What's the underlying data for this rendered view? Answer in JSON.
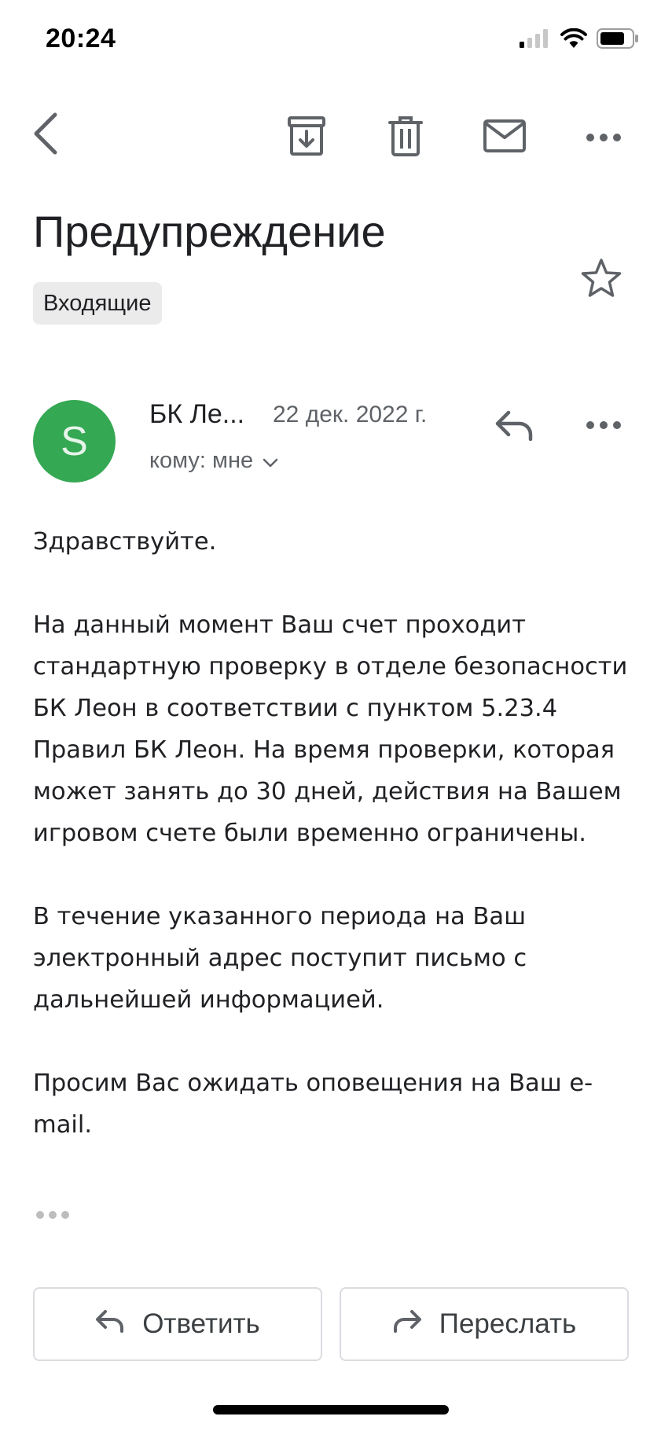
{
  "status_bar": {
    "time": "20:24",
    "icons": [
      "cellular-signal-icon",
      "wifi-icon",
      "battery-icon"
    ]
  },
  "toolbar": {
    "icons": [
      "back-arrow-icon",
      "archive-icon",
      "trash-icon",
      "mail-icon",
      "more-horizontal-icon"
    ]
  },
  "email": {
    "subject": "Предупреждение",
    "label": "Входящие",
    "sender": "БК Ле...",
    "avatar_letter": "S",
    "date": "22 дек. 2022 г.",
    "recipient": "кому: мне",
    "body": {
      "p1": "Здравствуйте.",
      "p2": "На данный момент Ваш счет проходит стандартную проверку в отделе безопасности БК Леон в соответствии с пунктом 5.23.4 Правил БК Леон. На время проверки, которая может занять до 30 дней, действия на Вашем игровом счете были временно ограничены.",
      "p3": "В течение указанного периода на Ваш электронный адрес поступит письмо с дальнейшей информацией.",
      "p4": "Просим Вас ожидать оповещения на Ваш e-mail."
    }
  },
  "actions": {
    "reply_label": "Ответить",
    "forward_label": "Переслать"
  },
  "colors": {
    "avatar": "#34a853",
    "icon_gray": "#5f6368",
    "chip_bg": "#ebebeb",
    "border": "#dadce0"
  }
}
